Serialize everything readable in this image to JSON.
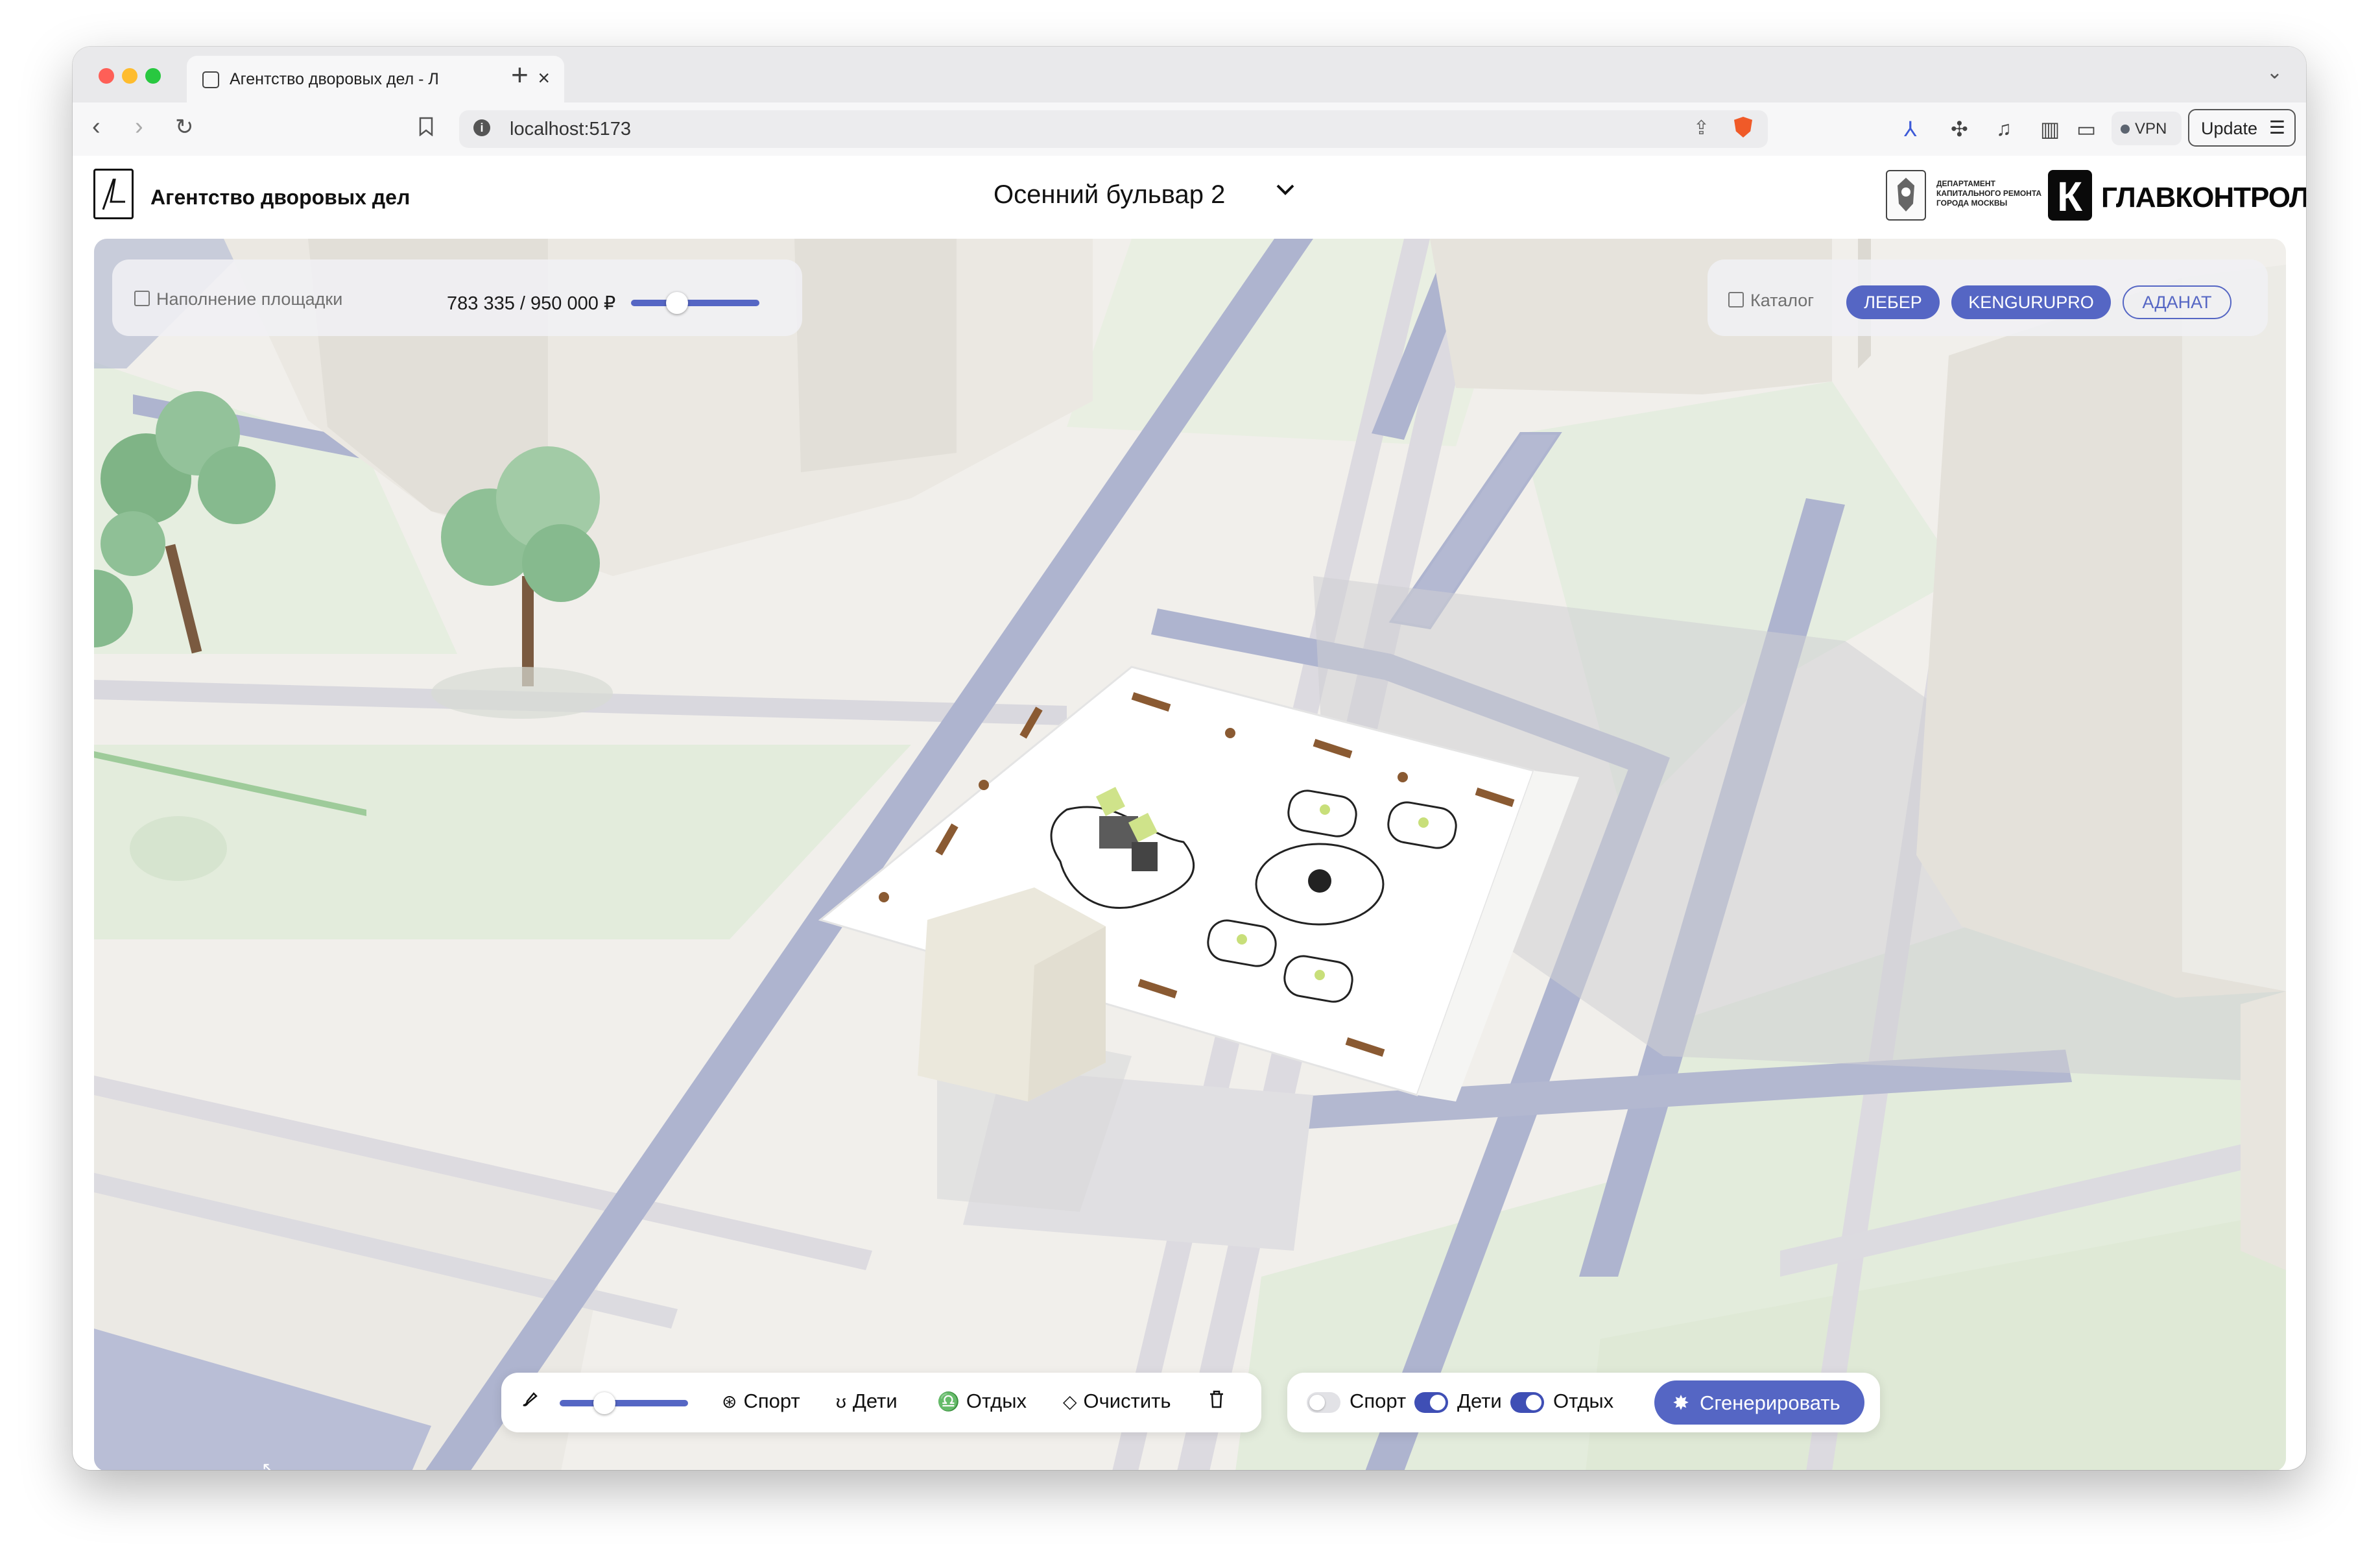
{
  "browser": {
    "tab_title": "Агентство дворовых дел - Л",
    "url": "localhost:5173",
    "vpn_label": "VPN",
    "update_label": "Update"
  },
  "header": {
    "brand": "Агентство дворовых дел",
    "project_name": "Осенний бульвар 2",
    "department_text": "Департамент капитального ремонта города Москвы",
    "partner_logo_text": "ГЛАВКОНТРОЛЬ",
    "partner_logo_letter": "К"
  },
  "budget_panel": {
    "label": "Наполнение площадки",
    "value": "783 335 / 950 000 ₽",
    "slider_fraction": 0.36
  },
  "catalog_panel": {
    "label": "Каталог",
    "chips": [
      {
        "label": "ЛЕБЕР",
        "active": true
      },
      {
        "label": "KENGURUPRO",
        "active": true
      },
      {
        "label": "АДАНАТ",
        "active": false
      }
    ]
  },
  "bottom_toolbar": {
    "slider_fraction": 0.35,
    "sport_label": "Спорт",
    "kids_label": "Дети",
    "rest_label": "Отдых",
    "clear_label": "Очистить"
  },
  "generate_bar": {
    "toggles": [
      {
        "label": "Спорт",
        "on": false
      },
      {
        "label": "Дети",
        "on": true
      },
      {
        "label": "Отдых",
        "on": true
      }
    ],
    "generate_label": "Сгенерировать"
  },
  "colors": {
    "accent": "#5566c4",
    "road": "#aeb4cf",
    "grass": "#e3ecdc",
    "building": "#ebe8e2"
  },
  "icons": [
    "back-icon",
    "forward-icon",
    "reload-icon",
    "bookmark-icon",
    "info-icon",
    "share-icon",
    "brave-icon",
    "extensions-icon",
    "music-icon",
    "sidebar-icon",
    "wallet-icon",
    "menu-icon",
    "chevron-down-icon",
    "brush-icon",
    "ball-icon",
    "bear-icon",
    "bell-icon",
    "eraser-icon",
    "trash-icon",
    "sparkle-icon"
  ]
}
